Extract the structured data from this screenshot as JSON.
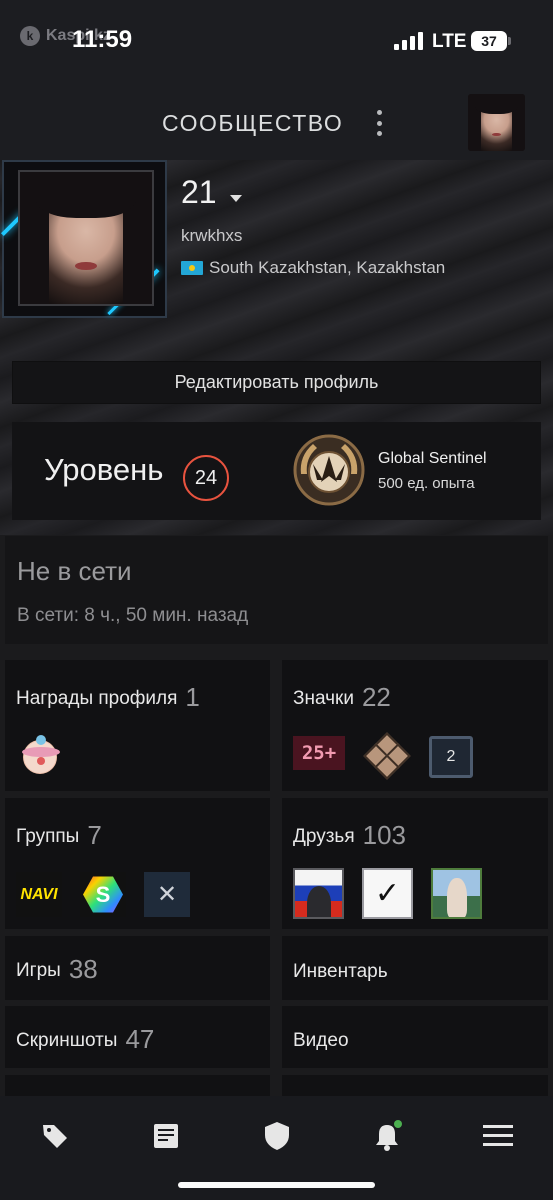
{
  "status_bar": {
    "carrier": "Kaspi.kz",
    "time": "11:59",
    "network": "LTE",
    "battery": "37"
  },
  "header": {
    "title": "СООБЩЕСТВО",
    "menu_icon": "more-vertical-icon",
    "avatar_icon": "user-avatar"
  },
  "profile": {
    "display_name": "21",
    "real_name": "krwkhxs",
    "location": "South Kazakhstan, Kazakhstan",
    "flag_icon": "kazakhstan-flag-icon"
  },
  "actions": {
    "edit_profile": "Редактировать профиль"
  },
  "level": {
    "label": "Уровень",
    "value": "24",
    "rank_name": "Global Sentinel",
    "rank_xp": "500 ед. опыта",
    "accent": "#e8533f"
  },
  "status": {
    "state": "Не в сети",
    "last_online": "В сети: 8 ч., 50 мин. назад"
  },
  "tiles": {
    "awards": {
      "label": "Награды профиля",
      "count": "1",
      "icons": [
        "clown-award-icon"
      ]
    },
    "badges": {
      "label": "Значки",
      "count": "22",
      "icons": [
        "badge-25-plus-icon",
        "badge-cube-icon",
        "badge-level-2-icon"
      ],
      "badge_25_text": "25+",
      "badge_two_text": "2"
    },
    "groups": {
      "label": "Группы",
      "count": "7",
      "icons": [
        "navi-group-icon",
        "s-group-icon",
        "x-group-icon"
      ],
      "navi_text": "NAVI",
      "s_text": "S",
      "x_text": "✕"
    },
    "friends": {
      "label": "Друзья",
      "count": "103",
      "icons": [
        "friend-avatar-russia",
        "friend-avatar-nike",
        "friend-avatar-photo"
      ],
      "nike_glyph": "✓"
    },
    "games": {
      "label": "Игры",
      "count": "38"
    },
    "inventory": {
      "label": "Инвентарь"
    },
    "screenshots": {
      "label": "Скриншоты",
      "count": "47"
    },
    "videos": {
      "label": "Видео"
    }
  },
  "nav": {
    "items": [
      "store-tag-icon",
      "news-icon",
      "shield-icon",
      "bell-icon",
      "hamburger-menu-icon"
    ],
    "notification_dot_color": "#4caf50"
  }
}
